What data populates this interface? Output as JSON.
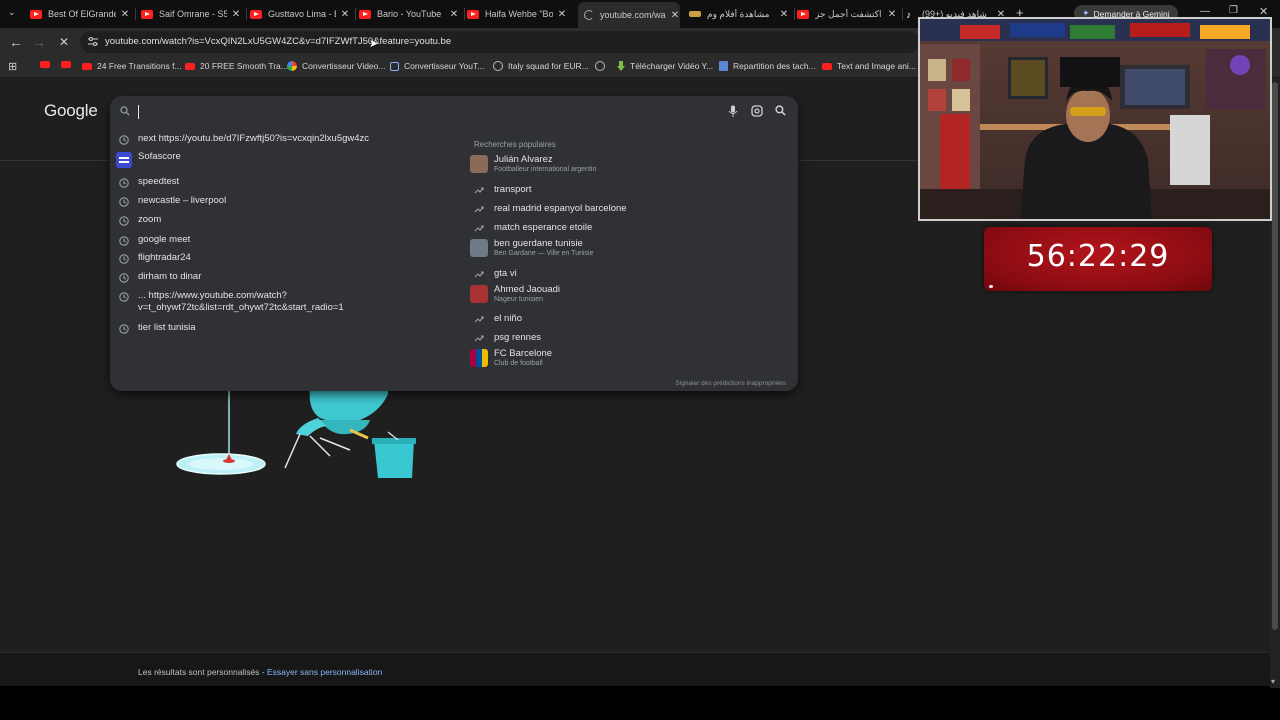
{
  "tabs": [
    {
      "title": "Best Of ElGrande",
      "icon": "youtube-icon"
    },
    {
      "title": "Saif Omrane - S5",
      "icon": "youtube-icon"
    },
    {
      "title": "Gusttavo Lima - E",
      "icon": "youtube-icon"
    },
    {
      "title": "Bario - YouTube",
      "icon": "youtube-icon"
    },
    {
      "title": "Haifa Wehbe \"Bo",
      "icon": "youtube-icon"
    },
    {
      "title": "youtube.com/wa",
      "icon": "loading-icon",
      "active": true
    },
    {
      "title": "مشاهدة أفلام وم",
      "icon": "site-icon"
    },
    {
      "title": "اكتشفت أجمل جز",
      "icon": "youtube-icon"
    },
    {
      "title": "(99+) شاهد فيديو",
      "icon": "tiktok-icon"
    }
  ],
  "gemini_label": "Demander à Gemini",
  "address": {
    "url": "youtube.com/watch?is=VcxQIN2LxU5GW4ZC&v=d7IFZWfTJ50&feature=youtu.be"
  },
  "bookmarks": [
    {
      "label": "",
      "icon": "youtube"
    },
    {
      "label": "",
      "icon": "youtube"
    },
    {
      "label": "24 Free Transitions f...",
      "icon": "youtube"
    },
    {
      "label": "20 FREE Smooth Tra...",
      "icon": "youtube"
    },
    {
      "label": "Convertisseur Video...",
      "icon": "google"
    },
    {
      "label": "Convertisseur YouT...",
      "icon": "recycle"
    },
    {
      "label": "Italy squad for EUR...",
      "icon": "globe"
    },
    {
      "label": "",
      "icon": "globe"
    },
    {
      "label": "Télécharger Vidéo Y...",
      "icon": "download"
    },
    {
      "label": "Repartition des tach...",
      "icon": "doc"
    },
    {
      "label": "Text and Image ani...",
      "icon": "youtube"
    }
  ],
  "google_logo": "Google",
  "search": {
    "value": "",
    "suggestions": [
      {
        "text": "next https://youtu.be/d7IFzwftj50?is=vcxqin2lxu5gw4zc",
        "icon": "history-icon"
      },
      {
        "text": "Sofascore",
        "icon": "sofascore-icon"
      },
      {
        "text": "speedtest",
        "icon": "history-icon"
      },
      {
        "text": "newcastle – liverpool",
        "icon": "history-icon"
      },
      {
        "text": "zoom",
        "icon": "history-icon"
      },
      {
        "text": "google meet",
        "icon": "history-icon"
      },
      {
        "text": "flightradar24",
        "icon": "history-icon"
      },
      {
        "text": "dirham to dinar",
        "icon": "history-icon"
      },
      {
        "text": "... https://www.youtube.com/watch?\nv=t_ohywt72tc&list=rdt_ohywt72tc&start_radio=1",
        "icon": "history-icon"
      },
      {
        "text": "tier list tunisia",
        "icon": "history-icon"
      }
    ],
    "popular_title": "Recherches populaires",
    "popular": [
      {
        "text": "Julián Alvarez",
        "sub": "Footballeur international argentin",
        "icon": "person-thumb"
      },
      {
        "text": "transport",
        "sub": "",
        "icon": "trending-icon"
      },
      {
        "text": "real madrid espanyol barcelone",
        "sub": "",
        "icon": "trending-icon"
      },
      {
        "text": "match esperance etoile",
        "sub": "",
        "icon": "trending-icon"
      },
      {
        "text": "ben guerdane tunisie",
        "sub": "Ben Gardane — Ville en Tunisie",
        "icon": "city-thumb"
      },
      {
        "text": "gta vi",
        "sub": "",
        "icon": "trending-icon"
      },
      {
        "text": "Ahmed Jaouadi",
        "sub": "Nageur tunisien",
        "icon": "person-thumb"
      },
      {
        "text": "el niño",
        "sub": "",
        "icon": "trending-icon"
      },
      {
        "text": "psg rennes",
        "sub": "",
        "icon": "trending-icon"
      },
      {
        "text": "FC Barcelone",
        "sub": "Club de football",
        "icon": "club-thumb"
      }
    ],
    "report_link": "Signaler des prédictions inappropriées"
  },
  "footer": {
    "text": "Les résultats sont personnalisés - ",
    "link": "Essayer sans personnalisation"
  },
  "timer": {
    "time": "56:22:29",
    "progress": 0.02
  },
  "colors": {
    "page_bg": "#1f1f1f",
    "dropdown_bg": "#303134",
    "timer_red": "#b3141b",
    "link_blue": "#8ab4f8"
  }
}
